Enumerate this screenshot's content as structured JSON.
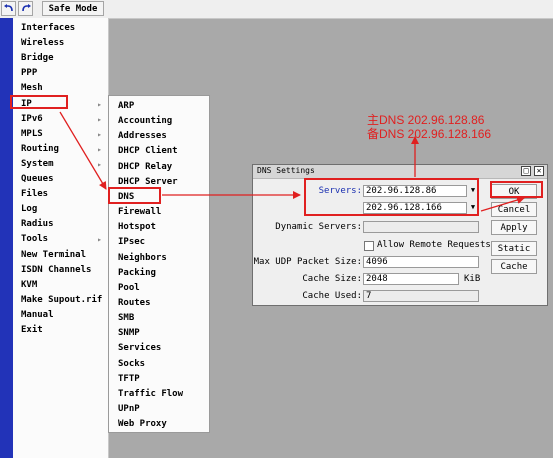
{
  "toolbar": {
    "undo_icon": "undo-icon",
    "redo_icon": "redo-icon",
    "safe_mode_label": "Safe Mode"
  },
  "main_menu": {
    "items": [
      {
        "label": "Interfaces",
        "has_submenu": false
      },
      {
        "label": "Wireless",
        "has_submenu": false
      },
      {
        "label": "Bridge",
        "has_submenu": false
      },
      {
        "label": "PPP",
        "has_submenu": false
      },
      {
        "label": "Mesh",
        "has_submenu": false
      },
      {
        "label": "IP",
        "has_submenu": true,
        "highlighted": true
      },
      {
        "label": "IPv6",
        "has_submenu": true
      },
      {
        "label": "MPLS",
        "has_submenu": true
      },
      {
        "label": "Routing",
        "has_submenu": true
      },
      {
        "label": "System",
        "has_submenu": true
      },
      {
        "label": "Queues",
        "has_submenu": false
      },
      {
        "label": "Files",
        "has_submenu": false
      },
      {
        "label": "Log",
        "has_submenu": false
      },
      {
        "label": "Radius",
        "has_submenu": false
      },
      {
        "label": "Tools",
        "has_submenu": true
      },
      {
        "label": "New Terminal",
        "has_submenu": false
      },
      {
        "label": "ISDN Channels",
        "has_submenu": false
      },
      {
        "label": "KVM",
        "has_submenu": false
      },
      {
        "label": "Make Supout.rif",
        "has_submenu": false
      },
      {
        "label": "Manual",
        "has_submenu": false
      },
      {
        "label": "Exit",
        "has_submenu": false
      }
    ]
  },
  "ip_submenu": {
    "items": [
      {
        "label": "ARP"
      },
      {
        "label": "Accounting"
      },
      {
        "label": "Addresses"
      },
      {
        "label": "DHCP Client"
      },
      {
        "label": "DHCP Relay"
      },
      {
        "label": "DHCP Server"
      },
      {
        "label": "DNS",
        "highlighted": true
      },
      {
        "label": "Firewall"
      },
      {
        "label": "Hotspot"
      },
      {
        "label": "IPsec"
      },
      {
        "label": "Neighbors"
      },
      {
        "label": "Packing"
      },
      {
        "label": "Pool"
      },
      {
        "label": "Routes"
      },
      {
        "label": "SMB"
      },
      {
        "label": "SNMP"
      },
      {
        "label": "Services"
      },
      {
        "label": "Socks"
      },
      {
        "label": "TFTP"
      },
      {
        "label": "Traffic Flow"
      },
      {
        "label": "UPnP"
      },
      {
        "label": "Web Proxy"
      }
    ]
  },
  "dns_dialog": {
    "title": "DNS Settings",
    "servers_label": "Servers:",
    "server_1": "202.96.128.86",
    "server_2": "202.96.128.166",
    "dynamic_servers_label": "Dynamic Servers:",
    "dynamic_servers_value": "",
    "allow_remote_label": "Allow Remote Requests",
    "allow_remote_checked": false,
    "max_udp_label": "Max UDP Packet Size:",
    "max_udp_value": "4096",
    "cache_size_label": "Cache Size:",
    "cache_size_value": "2048",
    "cache_size_unit": "KiB",
    "cache_used_label": "Cache Used:",
    "cache_used_value": "7",
    "buttons": {
      "ok": "OK",
      "cancel": "Cancel",
      "apply": "Apply",
      "static": "Static",
      "cache": "Cache"
    }
  },
  "annotation": {
    "primary_dns": "主DNS 202.96.128.86",
    "secondary_dns": "备DNS 202.96.128.166"
  },
  "colors": {
    "highlight_red": "#e02020",
    "sidebar_blue": "#2233b8",
    "server_label_blue": "#1a2fb0",
    "desktop_gray": "#a9a9a9"
  }
}
